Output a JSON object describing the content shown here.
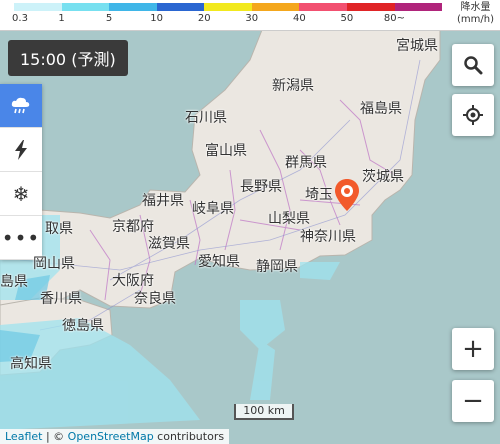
{
  "legend": {
    "colors": [
      "#cdf2f9",
      "#77e0f0",
      "#3fb6e8",
      "#2a66d1",
      "#f2e91e",
      "#f4a71d",
      "#f25070",
      "#e02426",
      "#b0247b"
    ],
    "ticks": [
      "0.3",
      "1",
      "5",
      "10",
      "20",
      "30",
      "40",
      "50",
      "80~"
    ],
    "unit_line1": "降水量",
    "unit_line2": "(mm/h)"
  },
  "time_label": "15:00 (予測)",
  "side_controls": [
    {
      "name": "rain-cloud-icon",
      "active": true
    },
    {
      "name": "lightning-icon",
      "active": false
    },
    {
      "name": "snowflake-icon",
      "active": false
    },
    {
      "name": "more-icon",
      "active": false
    }
  ],
  "prefectures": [
    {
      "name": "宮城県"
    },
    {
      "name": "新潟県"
    },
    {
      "name": "福島県"
    },
    {
      "name": "石川県"
    },
    {
      "name": "富山県"
    },
    {
      "name": "群馬県"
    },
    {
      "name": "茨城県"
    },
    {
      "name": "長野県"
    },
    {
      "name": "埼玉"
    },
    {
      "name": "福井県"
    },
    {
      "name": "岐阜県"
    },
    {
      "name": "山梨県"
    },
    {
      "name": "京都府"
    },
    {
      "name": "滋賀県"
    },
    {
      "name": "神奈川県"
    },
    {
      "name": "愛知県"
    },
    {
      "name": "静岡県"
    },
    {
      "name": "大阪府"
    },
    {
      "name": "香川県"
    },
    {
      "name": "奈良県"
    },
    {
      "name": "徳島県"
    },
    {
      "name": "高知県"
    },
    {
      "name": "岡山県"
    },
    {
      "name": "取県"
    },
    {
      "name": "島県"
    }
  ],
  "scale_label": "100 km",
  "attribution": {
    "leaflet": "Leaflet",
    "sep": " | © ",
    "osm": "OpenStreetMap",
    "suffix": " contributors"
  }
}
